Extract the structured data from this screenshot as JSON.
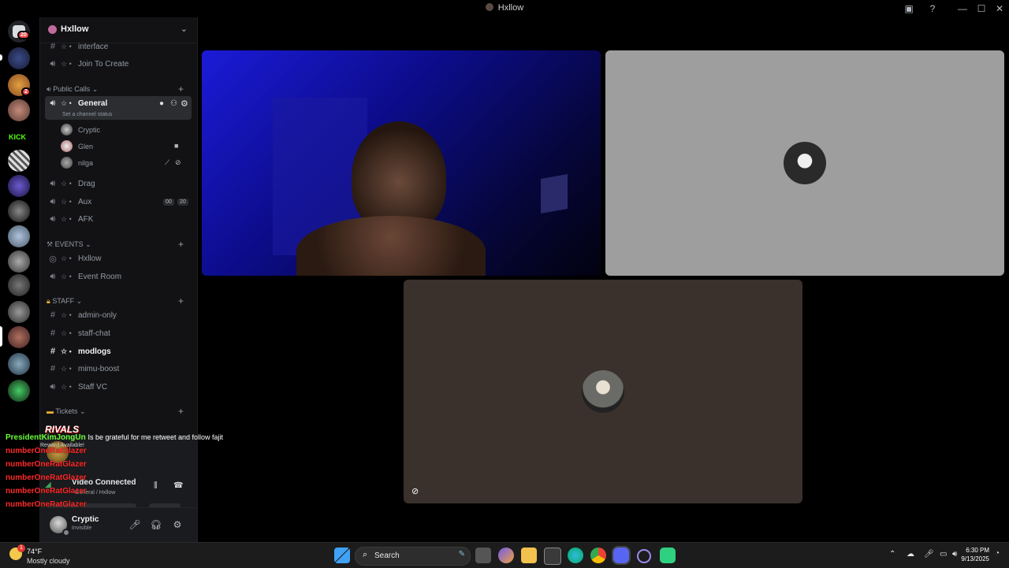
{
  "window": {
    "title": "Hxllow"
  },
  "rail": {
    "badges": {
      "home": "20",
      "server3": "2"
    },
    "kick_label": "KICK"
  },
  "guild": {
    "name": "Hxllow"
  },
  "channels": [
    {
      "key": "interface",
      "icon": "#",
      "name": "interface"
    },
    {
      "key": "join",
      "icon": "speaker",
      "name": "Join To Create"
    }
  ],
  "categories": {
    "public_calls": "Public Calls",
    "events": "EVENTS",
    "staff": "STAFF",
    "tickets": "Tickets"
  },
  "general": {
    "name": "General",
    "status_hint": "Set a channel status"
  },
  "voice_users": [
    "Cryptic",
    "Glen",
    "nilga"
  ],
  "more_channels": {
    "drag": "Drag",
    "aux": "Aux",
    "aux_badge_left": "00",
    "aux_badge_right": "20",
    "afk": "AFK",
    "hxllow": "Hxllow",
    "event_room": "Event Room",
    "admin_only": "admin-only",
    "staff_chat": "staff-chat",
    "modlogs": "modlogs",
    "mimu": "mimu-boost",
    "staff_vc": "Staff VC"
  },
  "overlay": {
    "line1_name": "PresidentKimJongUn",
    "line1_text": "Is be grateful for me retweet and follow fajit",
    "rivals": "RIVALS",
    "reward": "Reward Available!",
    "spam": "numberOneRatGlazer"
  },
  "voice_panel": {
    "status": "Video Connected",
    "sub": "General / Hxllow"
  },
  "user": {
    "name": "Cryptic",
    "status": "Invisible"
  },
  "taskbar": {
    "temp": "74°F",
    "weather": "Mostly cloudy",
    "weather_badge": "1",
    "search": "Search",
    "time": "6:30 PM",
    "date": "9/13/2025"
  }
}
